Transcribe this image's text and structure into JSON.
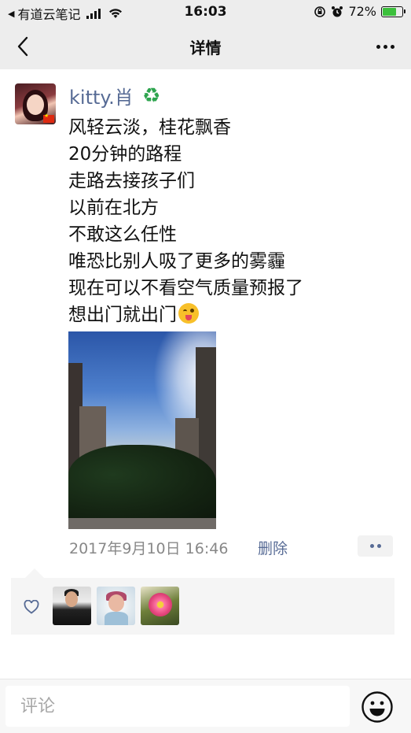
{
  "status_bar": {
    "back_app": "有道云笔记",
    "time": "16:03",
    "battery_percent": "72%",
    "battery_level": 0.72
  },
  "navbar": {
    "title": "详情",
    "back_icon": "chevron-left-icon",
    "more_icon": "more-horizontal-icon"
  },
  "post": {
    "username": "kitty.肖",
    "username_badge_icon": "recycle-icon",
    "text_lines": [
      "风轻云淡，桂花飘香",
      "20分钟的路程",
      "走路去接孩子们",
      "以前在北方",
      "不敢这么任性",
      "唯恐比别人吸了更多的雾霾",
      "现在可以不看空气质量预报了",
      "想出门就出门"
    ],
    "trailing_emoji": "wink-tongue-icon",
    "timestamp": "2017年9月10日 16:46",
    "delete_label": "删除"
  },
  "likes": {
    "icon": "heart-outline-icon",
    "count": 3
  },
  "comment_bar": {
    "placeholder": "评论",
    "emoji_icon": "smiley-icon"
  },
  "colors": {
    "link": "#576b95",
    "bar_background": "#ededed",
    "likes_background": "#f5f5f5"
  }
}
